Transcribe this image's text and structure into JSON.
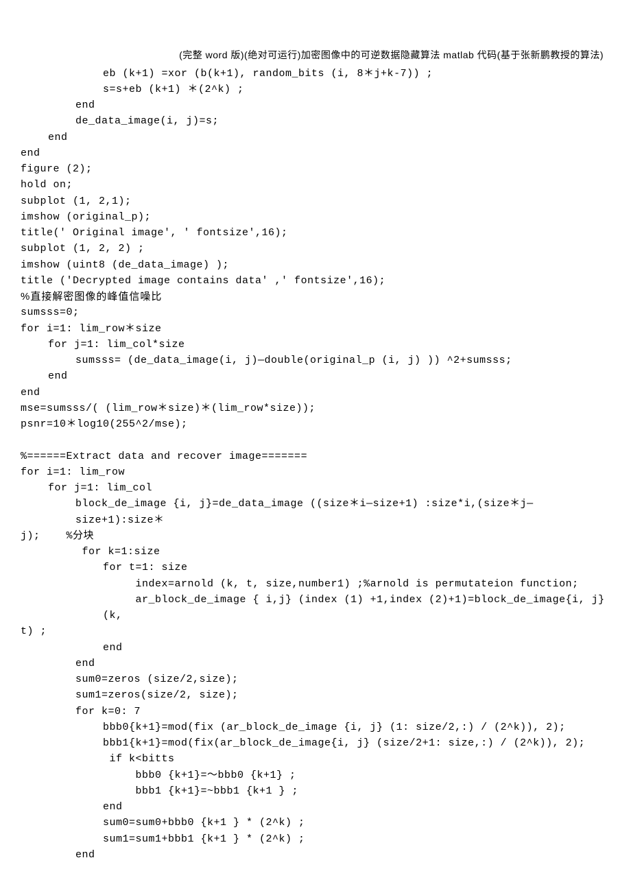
{
  "header": {
    "text": "(完整 word 版)(绝对可运行)加密图像中的可逆数据隐藏算法 matlab 代码(基于张新鹏教授的算法)"
  },
  "code": {
    "lines": [
      {
        "cls": "i1",
        "text": "eb (k+1) =xor (b(k+1), random_bits (i, 8＊j+k-7)) ;"
      },
      {
        "cls": "i1",
        "text": "s=s+eb (k+1) ＊(2^k) ;"
      },
      {
        "cls": "i2",
        "text": "end"
      },
      {
        "cls": "i2",
        "text": "de_data_image(i, j)=s;"
      },
      {
        "cls": "i3",
        "text": "end"
      },
      {
        "cls": "i4",
        "text": "end"
      },
      {
        "cls": "i4",
        "text": "figure (2);"
      },
      {
        "cls": "i4",
        "text": "hold on;"
      },
      {
        "cls": "i4",
        "text": "subplot (1, 2,1);"
      },
      {
        "cls": "i4",
        "text": "imshow (original_p);"
      },
      {
        "cls": "i4",
        "text": "title(' Original image', ' fontsize',16);"
      },
      {
        "cls": "i4",
        "text": "subplot (1, 2, 2) ;"
      },
      {
        "cls": "i4",
        "text": "imshow (uint8 (de_data_image) );"
      },
      {
        "cls": "i4",
        "text": "title ('Decrypted image contains data' ,' fontsize',16);"
      },
      {
        "cls": "i4 cn",
        "text": "%直接解密图像的峰值信噪比"
      },
      {
        "cls": "i4",
        "text": "sumsss=0;"
      },
      {
        "cls": "i4",
        "text": "for i=1: lim_row＊size"
      },
      {
        "cls": "i3",
        "text": "for j=1: lim_col*size"
      },
      {
        "cls": "i2",
        "text": "sumsss= (de_data_image(i, j)—double(original_p (i, j) )) ^2+sumsss;"
      },
      {
        "cls": "i3",
        "text": "end"
      },
      {
        "cls": "i4",
        "text": "end"
      },
      {
        "cls": "i4",
        "text": "mse=sumsss/( (lim_row＊size)＊(lim_row*size));"
      },
      {
        "cls": "i4",
        "text": "psnr=10＊log10(255^2/mse);"
      },
      {
        "cls": "empty",
        "text": ""
      },
      {
        "cls": "i4",
        "text": "%======Extract data and recover image======="
      },
      {
        "cls": "i4",
        "text": "for i=1: lim_row"
      },
      {
        "cls": "i3",
        "text": "for j=1: lim_col"
      },
      {
        "cls": "i2",
        "text": "block_de_image {i, j}=de_data_image ((size＊i—size+1) :size*i,(size＊j—size+1):size＊"
      },
      {
        "cls": "i4",
        "text": "j);    %分块"
      },
      {
        "cls": "i2",
        "text": " for k=1:size"
      },
      {
        "cls": "i1",
        "text": "for t=1: size"
      },
      {
        "cls": "i1",
        "text": "     index=arnold (k, t, size,number1) ;%arnold is permutateion function;"
      },
      {
        "cls": "i1",
        "text": "     ar_block_de_image { i,j} (index (1) +1,index (2)+1)=block_de_image{i, j} (k,"
      },
      {
        "cls": "i4",
        "text": "t) ;"
      },
      {
        "cls": "i1",
        "text": "end"
      },
      {
        "cls": "i2",
        "text": "end"
      },
      {
        "cls": "i2",
        "text": "sum0=zeros (size/2,size);"
      },
      {
        "cls": "i2",
        "text": "sum1=zeros(size/2, size);"
      },
      {
        "cls": "i2",
        "text": "for k=0: 7"
      },
      {
        "cls": "i1",
        "text": "bbb0{k+1}=mod(fix (ar_block_de_image {i, j} (1: size/2,:) / (2^k)), 2);"
      },
      {
        "cls": "i1",
        "text": "bbb1{k+1}=mod(fix(ar_block_de_image{i, j} (size/2+1: size,:) / (2^k)), 2);"
      },
      {
        "cls": "i1",
        "text": " if k<bitts"
      },
      {
        "cls": "i1",
        "text": "     bbb0 {k+1}=～bbb0 {k+1} ;"
      },
      {
        "cls": "i1",
        "text": "     bbb1 {k+1}=~bbb1 {k+1 } ;"
      },
      {
        "cls": "i1",
        "text": "end"
      },
      {
        "cls": "i1",
        "text": "sum0=sum0+bbb0 {k+1 } * (2^k) ;"
      },
      {
        "cls": "i1",
        "text": "sum1=sum1+bbb1 {k+1 } * (2^k) ;"
      },
      {
        "cls": "i2",
        "text": "end"
      }
    ]
  }
}
